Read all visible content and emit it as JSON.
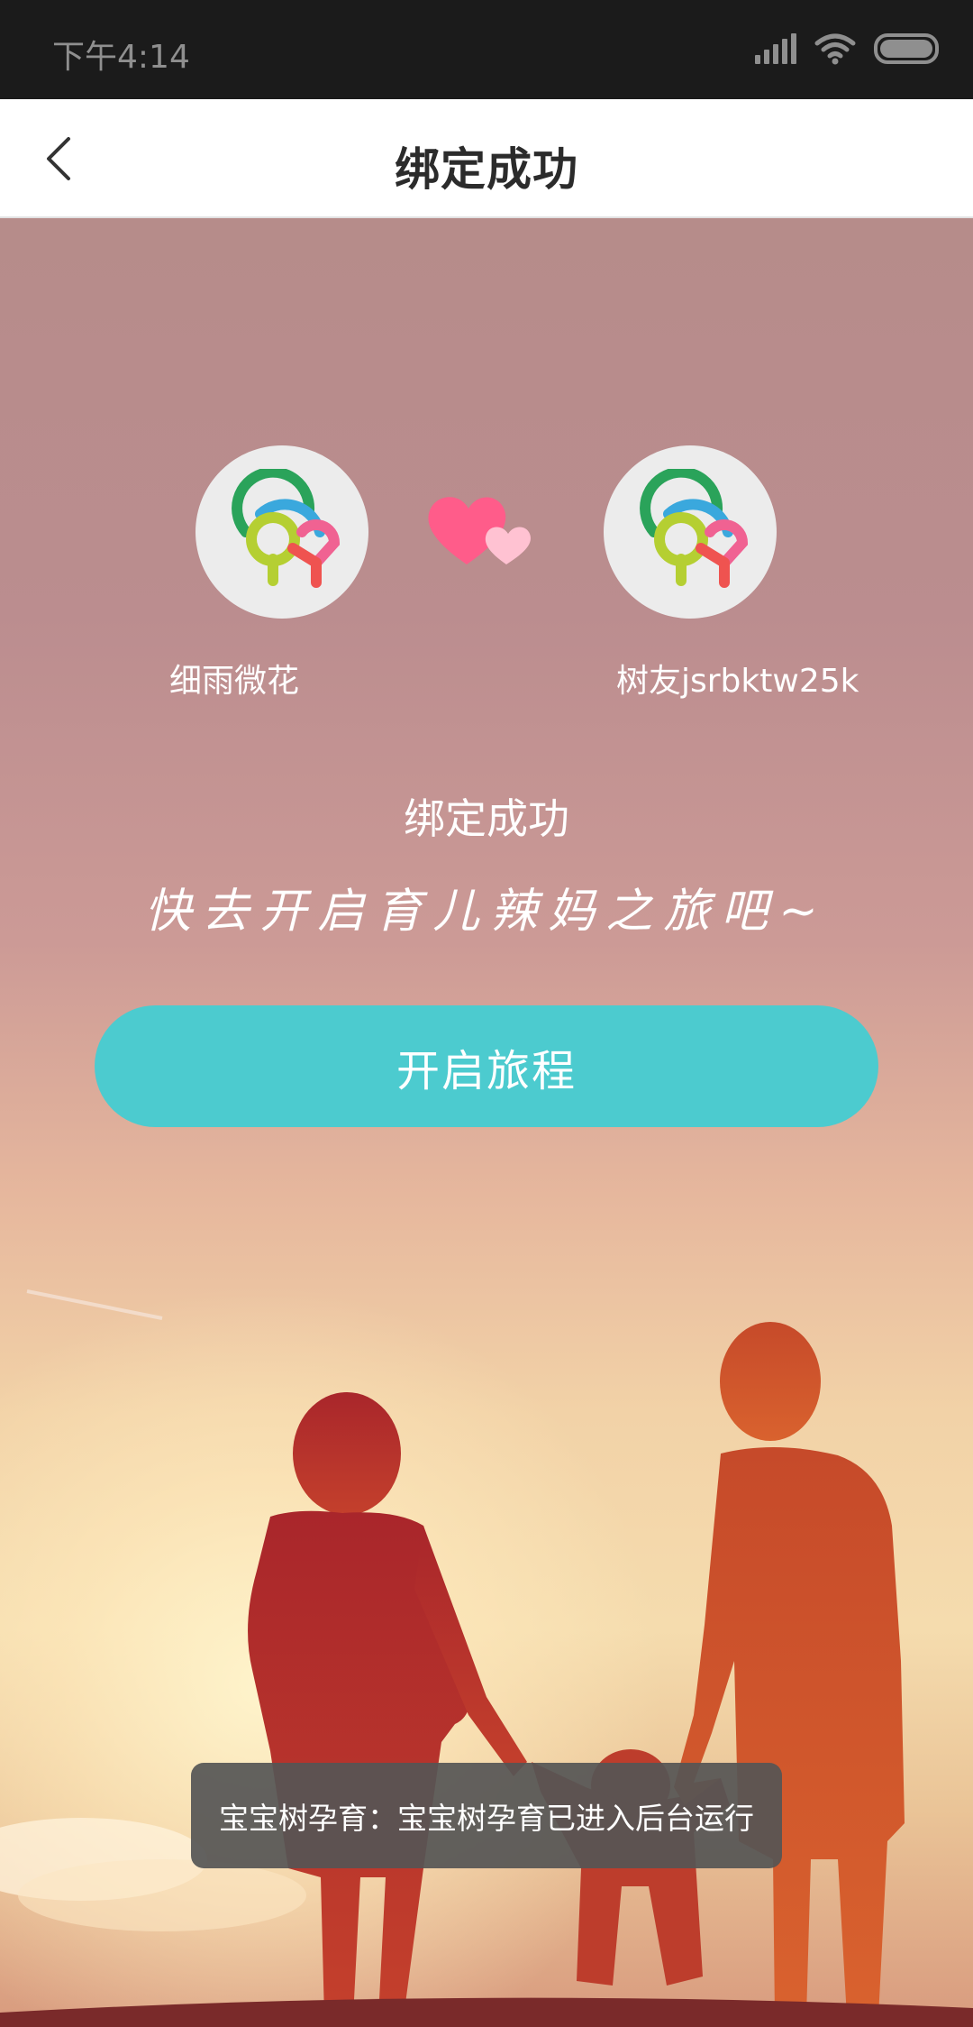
{
  "status_bar": {
    "time": "下午4:14",
    "icons": [
      "signal-icon",
      "wifi-icon",
      "battery-icon"
    ]
  },
  "header": {
    "title": "绑定成功",
    "back_icon": "chevron-left-icon"
  },
  "binding": {
    "left_user": {
      "name": "细雨微花",
      "avatar": "app-logo-avatar"
    },
    "right_user": {
      "name": "树友jsrbktw25k",
      "avatar": "app-logo-avatar"
    },
    "hearts_icon": "double-heart-icon",
    "success_text": "绑定成功",
    "slogan": "快去开启育儿辣妈之旅吧~"
  },
  "actions": {
    "start_label": "开启旅程"
  },
  "toast": {
    "text": "宝宝树孕育：宝宝树孕育已进入后台运行"
  },
  "colors": {
    "accent": "#4ccbcf",
    "status_bar_bg": "#1b1b1b",
    "heart_pink": "#ff5c8a",
    "heart_light": "#ffc2d2",
    "toast_bg": "#555555"
  }
}
